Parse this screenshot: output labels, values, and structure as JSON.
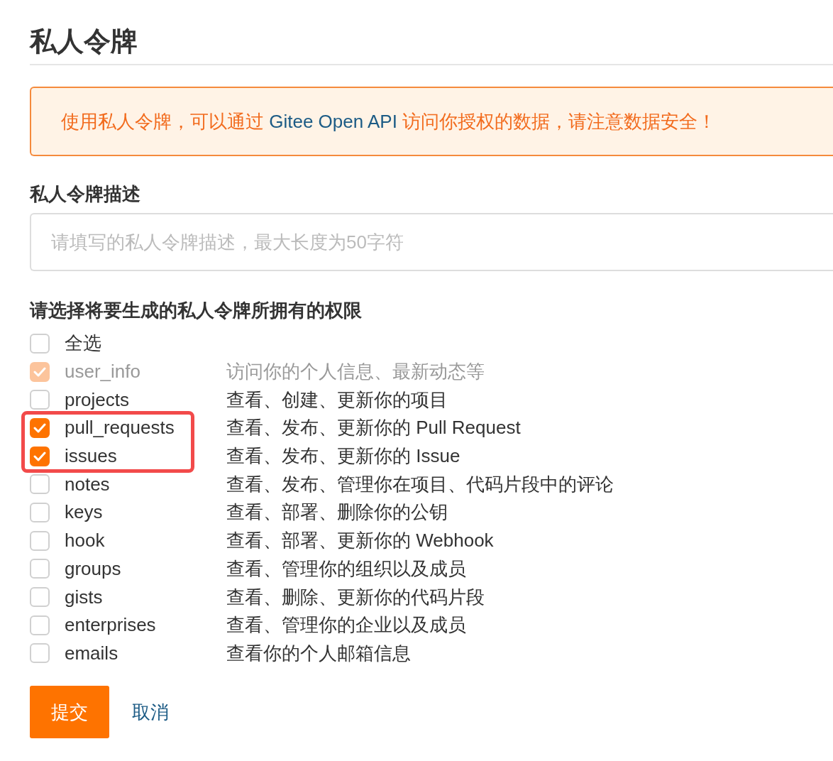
{
  "title": "私人令牌",
  "notice": {
    "before": "使用私人令牌，可以通过 ",
    "link": "Gitee Open API",
    "after": " 访问你授权的数据，请注意数据安全！"
  },
  "description": {
    "label": "私人令牌描述",
    "placeholder": "请填写的私人令牌描述，最大长度为50字符"
  },
  "permissions_label": "请选择将要生成的私人令牌所拥有的权限",
  "select_all": {
    "label": "全选",
    "checked": false
  },
  "permissions": [
    {
      "name": "user_info",
      "description": "访问你的个人信息、最新动态等",
      "checked": true,
      "disabled": true,
      "highlighted": false
    },
    {
      "name": "projects",
      "description": "查看、创建、更新你的项目",
      "checked": false,
      "disabled": false,
      "highlighted": false
    },
    {
      "name": "pull_requests",
      "description": "查看、发布、更新你的 Pull Request",
      "checked": true,
      "disabled": false,
      "highlighted": true
    },
    {
      "name": "issues",
      "description": "查看、发布、更新你的 Issue",
      "checked": true,
      "disabled": false,
      "highlighted": true
    },
    {
      "name": "notes",
      "description": "查看、发布、管理你在项目、代码片段中的评论",
      "checked": false,
      "disabled": false,
      "highlighted": false
    },
    {
      "name": "keys",
      "description": "查看、部署、删除你的公钥",
      "checked": false,
      "disabled": false,
      "highlighted": false
    },
    {
      "name": "hook",
      "description": "查看、部署、更新你的 Webhook",
      "checked": false,
      "disabled": false,
      "highlighted": false
    },
    {
      "name": "groups",
      "description": "查看、管理你的组织以及成员",
      "checked": false,
      "disabled": false,
      "highlighted": false
    },
    {
      "name": "gists",
      "description": "查看、删除、更新你的代码片段",
      "checked": false,
      "disabled": false,
      "highlighted": false
    },
    {
      "name": "enterprises",
      "description": "查看、管理你的企业以及成员",
      "checked": false,
      "disabled": false,
      "highlighted": false
    },
    {
      "name": "emails",
      "description": "查看你的个人邮箱信息",
      "checked": false,
      "disabled": false,
      "highlighted": false
    }
  ],
  "buttons": {
    "submit": "提交",
    "cancel": "取消"
  }
}
